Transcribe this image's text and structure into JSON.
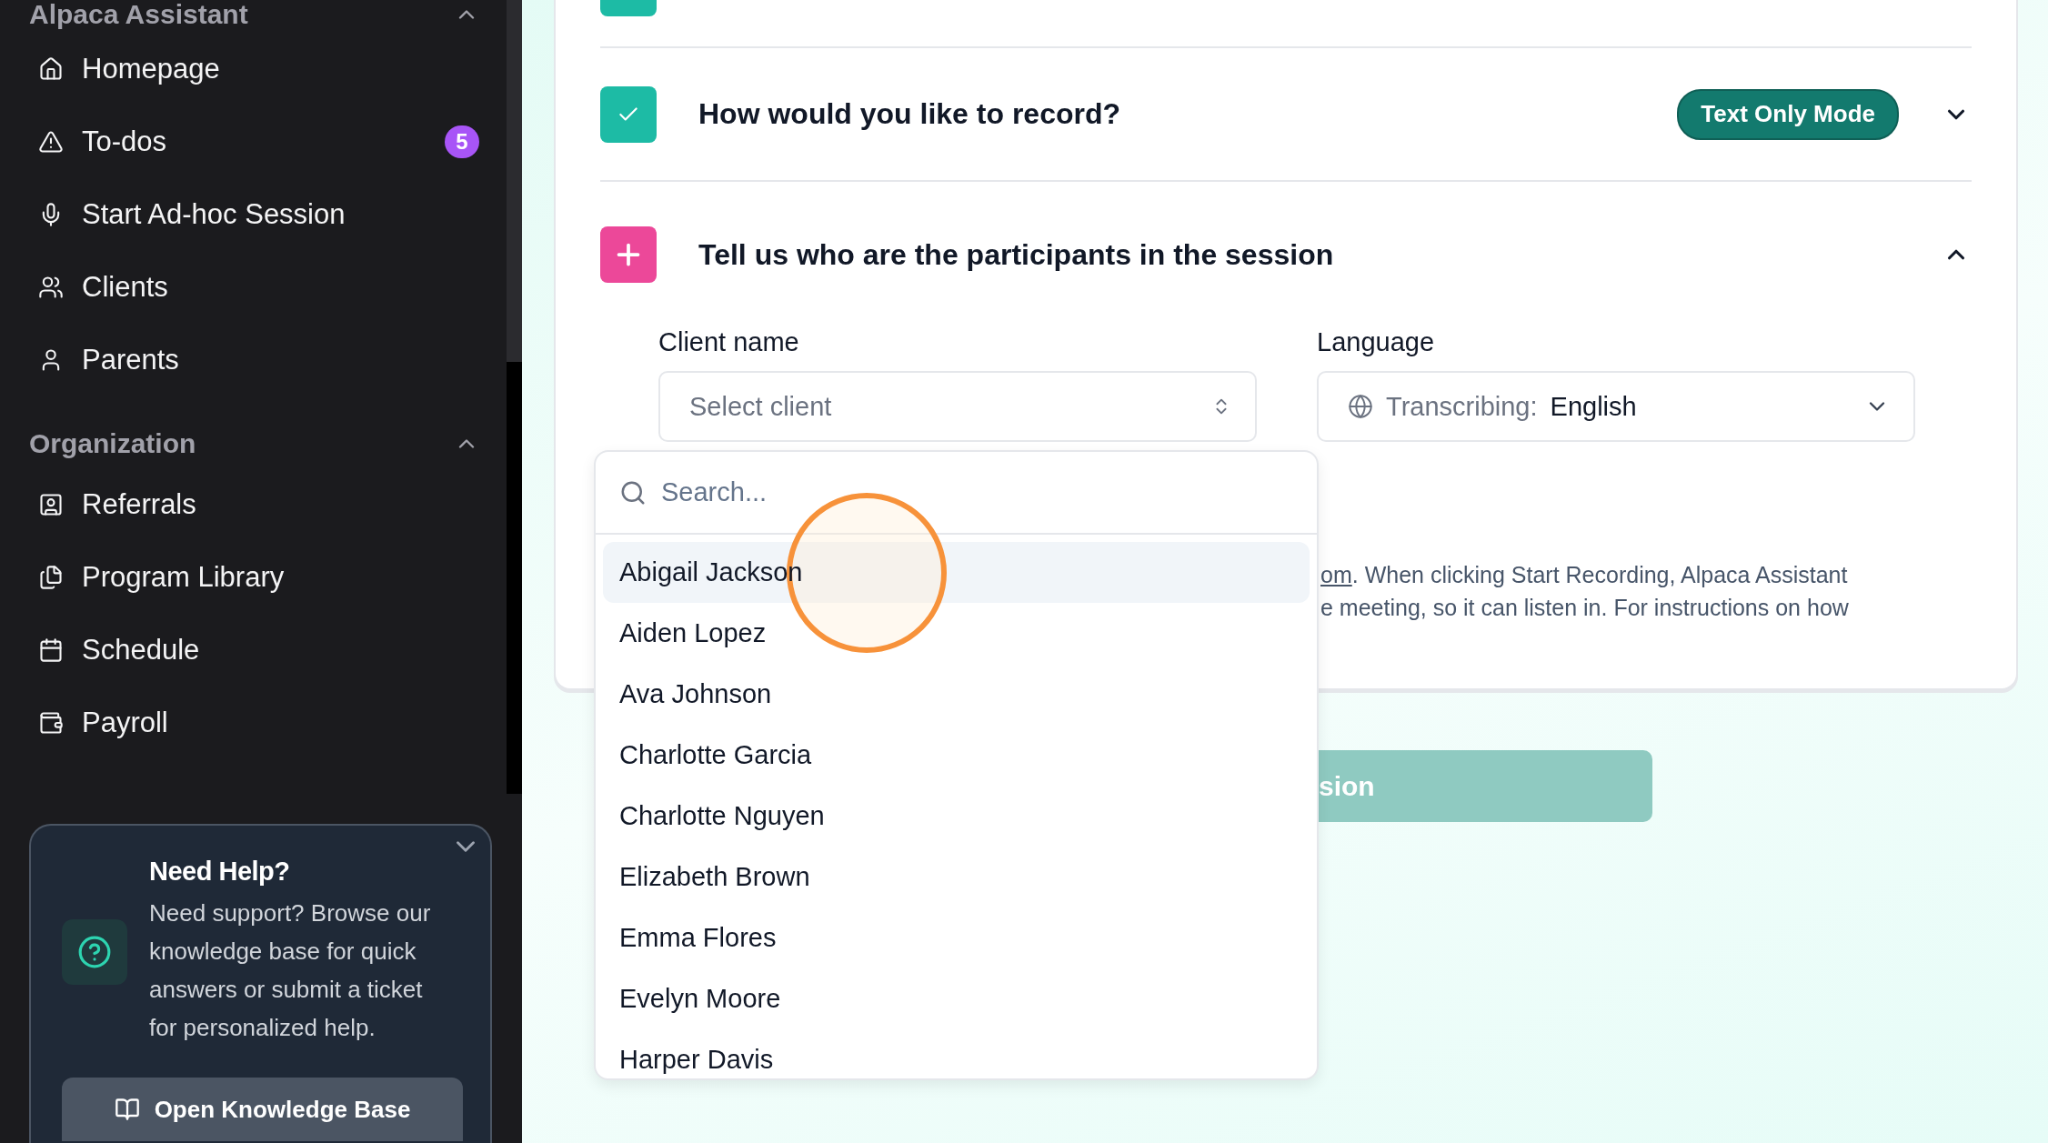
{
  "sidebar": {
    "sections": [
      {
        "title": "Alpaca Assistant",
        "expanded": true,
        "items": [
          {
            "label": "Homepage"
          },
          {
            "label": "To-dos",
            "badge": "5"
          },
          {
            "label": "Start Ad-hoc Session"
          },
          {
            "label": "Clients"
          },
          {
            "label": "Parents"
          }
        ]
      },
      {
        "title": "Organization",
        "expanded": true,
        "items": [
          {
            "label": "Referrals"
          },
          {
            "label": "Program Library"
          },
          {
            "label": "Schedule"
          },
          {
            "label": "Payroll"
          }
        ]
      }
    ],
    "help": {
      "title": "Need Help?",
      "body": "Need support? Browse our knowledge base for quick answers or submit a ticket for personalized help.",
      "button": "Open Knowledge Base",
      "expanded": true
    }
  },
  "steps": [
    {
      "checked": true
    },
    {
      "checked": true,
      "expanded": false,
      "title": "How would you like to record?",
      "badge": "Text Only Mode"
    },
    {
      "checked": false,
      "expanded": true,
      "title": "Tell us who are the participants in the session"
    }
  ],
  "participants": {
    "client_field": {
      "label": "Client name",
      "placeholder": "Select client"
    },
    "language_field": {
      "label": "Language",
      "prefix": "Transcribing:",
      "value": "English"
    },
    "note": {
      "link": "om",
      "lines": [
        ". When clicking Start Recording, Alpaca Assistant",
        "e meeting, so it can listen in. For instructions on how"
      ]
    }
  },
  "start_button": {
    "label": "sion"
  },
  "client_dropdown": {
    "search_placeholder": "Search...",
    "items": [
      {
        "label": "Abigail Jackson",
        "highlighted": true
      },
      {
        "label": "Aiden Lopez",
        "highlighted": false
      },
      {
        "label": "Ava Johnson",
        "highlighted": false
      },
      {
        "label": "Charlotte Garcia",
        "highlighted": false
      },
      {
        "label": "Charlotte Nguyen",
        "highlighted": false
      },
      {
        "label": "Elizabeth Brown",
        "highlighted": false
      },
      {
        "label": "Emma Flores",
        "highlighted": false
      },
      {
        "label": "Evelyn Moore",
        "highlighted": false
      },
      {
        "label": "Harper Davis",
        "highlighted": false
      }
    ]
  }
}
